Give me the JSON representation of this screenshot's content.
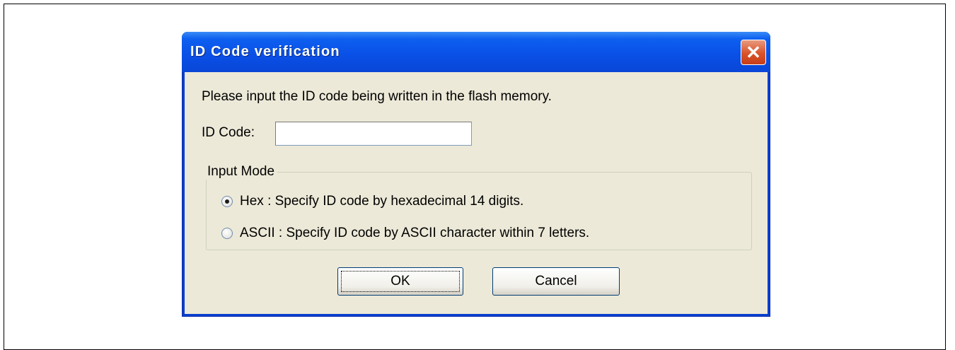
{
  "window": {
    "title": "ID Code verification",
    "close_icon": "close-icon"
  },
  "content": {
    "prompt": "Please input the ID code being written in the flash memory.",
    "id_code_label": "ID Code:",
    "id_code_value": "",
    "input_mode": {
      "legend": "Input Mode",
      "options": [
        {
          "label": "Hex : Specify ID code by hexadecimal 14 digits.",
          "checked": true
        },
        {
          "label": "ASCII : Specify ID code by ASCII character within 7 letters.",
          "checked": false
        }
      ]
    }
  },
  "buttons": {
    "ok": "OK",
    "cancel": "Cancel"
  },
  "colors": {
    "titlebar": "#0a4fe6",
    "client": "#ece9d8",
    "close": "#d8532a"
  }
}
